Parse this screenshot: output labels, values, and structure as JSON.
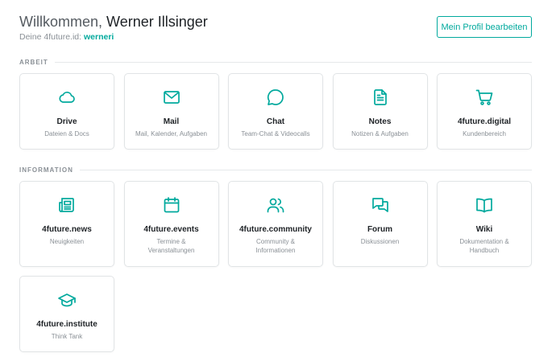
{
  "header": {
    "welcome_prefix": "Willkommen,",
    "user_name": "Werner Illsinger",
    "id_label": "Deine 4future.id:",
    "user_id": "werneri",
    "profile_button": "Mein Profil bearbeiten"
  },
  "sections": {
    "arbeit": "ARBEIT",
    "information": "INFORMATION"
  },
  "arbeit": [
    {
      "title": "Drive",
      "sub": "Dateien & Docs",
      "icon": "cloud-icon"
    },
    {
      "title": "Mail",
      "sub": "Mail, Kalender, Aufgaben",
      "icon": "mail-icon"
    },
    {
      "title": "Chat",
      "sub": "Team-Chat & Videocalls",
      "icon": "chat-bubble-icon"
    },
    {
      "title": "Notes",
      "sub": "Notizen & Aufgaben",
      "icon": "document-icon"
    },
    {
      "title": "4future.digital",
      "sub": "Kundenbereich",
      "icon": "shopping-cart-icon"
    }
  ],
  "information": [
    {
      "title": "4future.news",
      "sub": "Neuigkeiten",
      "icon": "newspaper-icon"
    },
    {
      "title": "4future.events",
      "sub": "Termine & Veranstaltungen",
      "icon": "calendar-icon"
    },
    {
      "title": "4future.community",
      "sub": "Community & Informationen",
      "icon": "users-icon"
    },
    {
      "title": "Forum",
      "sub": "Diskussionen",
      "icon": "chat-bubbles-icon"
    },
    {
      "title": "Wiki",
      "sub": "Dokumentation & Handbuch",
      "icon": "book-open-icon"
    },
    {
      "title": "4future.institute",
      "sub": "Think Tank",
      "icon": "graduation-cap-icon"
    }
  ],
  "colors": {
    "accent": "#00a99d",
    "border": "#e1e4e6",
    "muted_text": "#8a9096"
  }
}
